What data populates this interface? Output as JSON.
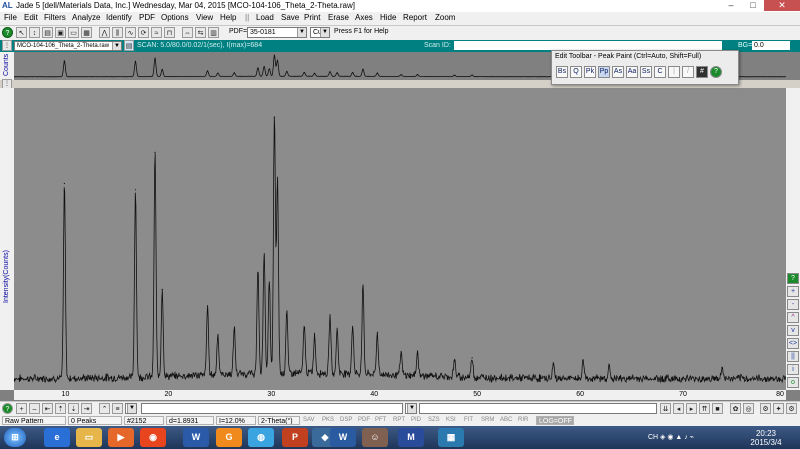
{
  "window": {
    "logo": "AL",
    "title": "Jade 5 [dell/Materials Data, Inc.] Wednesday, Mar 04, 2015 [MCO-104-106_Theta_2-Theta.raw]",
    "minimize": "–",
    "maximize": "□",
    "close": "✕"
  },
  "menu": [
    "File",
    "Edit",
    "Filters",
    "Analyze",
    "Identify",
    "PDF",
    "Options",
    "View",
    "Help",
    "Load",
    "Save",
    "Print",
    "Erase",
    "Axes",
    "Hide",
    "Report",
    "Zoom"
  ],
  "toolbar": {
    "pdf_label": "PDF=",
    "pdf_value": "35-0181",
    "anode_value": "Cu",
    "help_text": "Press F1 for Help"
  },
  "scan": {
    "file_value": "MCO-104-106_Theta_2-Theta.raw",
    "info": "SCAN: 5.0/80.0/0.02/1(sec), I(max)=684",
    "scan_id_label": "Scan ID:",
    "bg_label": "BG=",
    "bg_value": "0.0"
  },
  "overview": {
    "y_label": "Counts"
  },
  "plot": {
    "y_label": "Intensity(Counts)",
    "x_ticks": [
      "10",
      "20",
      "30",
      "40",
      "50",
      "60",
      "70",
      "80"
    ]
  },
  "chart_data": {
    "type": "line",
    "title": "",
    "xlabel": "2-Theta(°)",
    "ylabel": "Intensity(Counts)",
    "xlim": [
      5,
      80
    ],
    "ylim": [
      0,
      684
    ],
    "grid": false,
    "peaks": [
      {
        "x": 9.9,
        "y": 470
      },
      {
        "x": 16.8,
        "y": 455
      },
      {
        "x": 18.7,
        "y": 545
      },
      {
        "x": 19.4,
        "y": 215
      },
      {
        "x": 23.8,
        "y": 165
      },
      {
        "x": 24.8,
        "y": 100
      },
      {
        "x": 26.4,
        "y": 112
      },
      {
        "x": 28.7,
        "y": 255
      },
      {
        "x": 29.3,
        "y": 295
      },
      {
        "x": 29.8,
        "y": 225
      },
      {
        "x": 30.3,
        "y": 630
      },
      {
        "x": 30.6,
        "y": 475
      },
      {
        "x": 31.5,
        "y": 150
      },
      {
        "x": 33.2,
        "y": 118
      },
      {
        "x": 34.2,
        "y": 92
      },
      {
        "x": 35.7,
        "y": 140
      },
      {
        "x": 36.4,
        "y": 108
      },
      {
        "x": 37.9,
        "y": 120
      },
      {
        "x": 38.9,
        "y": 215
      },
      {
        "x": 40.3,
        "y": 102
      },
      {
        "x": 42.6,
        "y": 55
      },
      {
        "x": 44.2,
        "y": 60
      },
      {
        "x": 47.8,
        "y": 42
      },
      {
        "x": 49.5,
        "y": 50
      },
      {
        "x": 57.4,
        "y": 35
      },
      {
        "x": 60.3,
        "y": 45
      },
      {
        "x": 62.8,
        "y": 30
      },
      {
        "x": 73.8,
        "y": 26
      }
    ],
    "baseline": 8
  },
  "edit_toolbar": {
    "title": "Edit Toolbar - Peak Paint (Ctrl=Auto, Shift=Full)",
    "icons": [
      "Bs",
      "Q",
      "Pk",
      "Pp",
      "As",
      "Aa",
      "Ss",
      "C",
      "|",
      "/",
      "#",
      "?"
    ]
  },
  "right_tools": [
    "?",
    "+",
    "-",
    "^",
    "v",
    "<>",
    "||",
    "i",
    "o",
    "o",
    "■"
  ],
  "status": {
    "pattern": "Raw Pattern",
    "peaks": "0 Peaks",
    "cursor_count": "#2152",
    "d_value": "d=1.8931",
    "intensity": "I=12.0%",
    "axis_mode": "2-Theta(°)",
    "buttons": [
      "SAV",
      "PKS",
      "DSP",
      "PDF",
      "PFT",
      "RPT",
      "PID",
      "SZS",
      "KSI",
      "FIT",
      "SRM",
      "ABC",
      "RIR"
    ],
    "log": "LOG=OFF"
  },
  "taskbar": {
    "time": "20:23",
    "date": "2015/3/4",
    "apps": [
      "start",
      "ie",
      "explorer",
      "media",
      "wps",
      "chrome",
      "ppt",
      "qq",
      "word",
      "user",
      "jade",
      "paint"
    ]
  }
}
